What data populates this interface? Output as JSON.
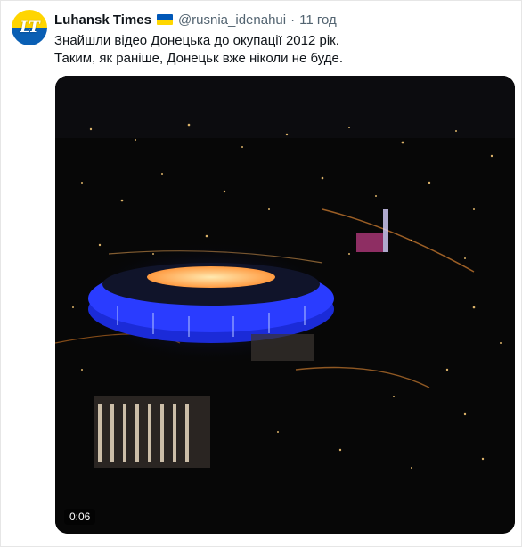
{
  "tweet": {
    "avatar_text": "LT",
    "display_name": "Luhansk Times",
    "handle": "@rusnia_idenahui",
    "separator": "·",
    "time": "11 год",
    "text_lines": [
      "Знайшли відео Донецька до окупації 2012 рік.",
      "Таким, як раніше, Донецьк вже ніколи не буде."
    ],
    "media": {
      "duration": "0:06",
      "content": "video"
    }
  },
  "colors": {
    "text_primary": "#0f1419",
    "text_secondary": "#536471",
    "avatar_yellow": "#ffd500",
    "avatar_blue": "#0a5fb4",
    "stadium_blue": "#2a3cff"
  },
  "icons": [
    "ukraine-flag-icon"
  ]
}
